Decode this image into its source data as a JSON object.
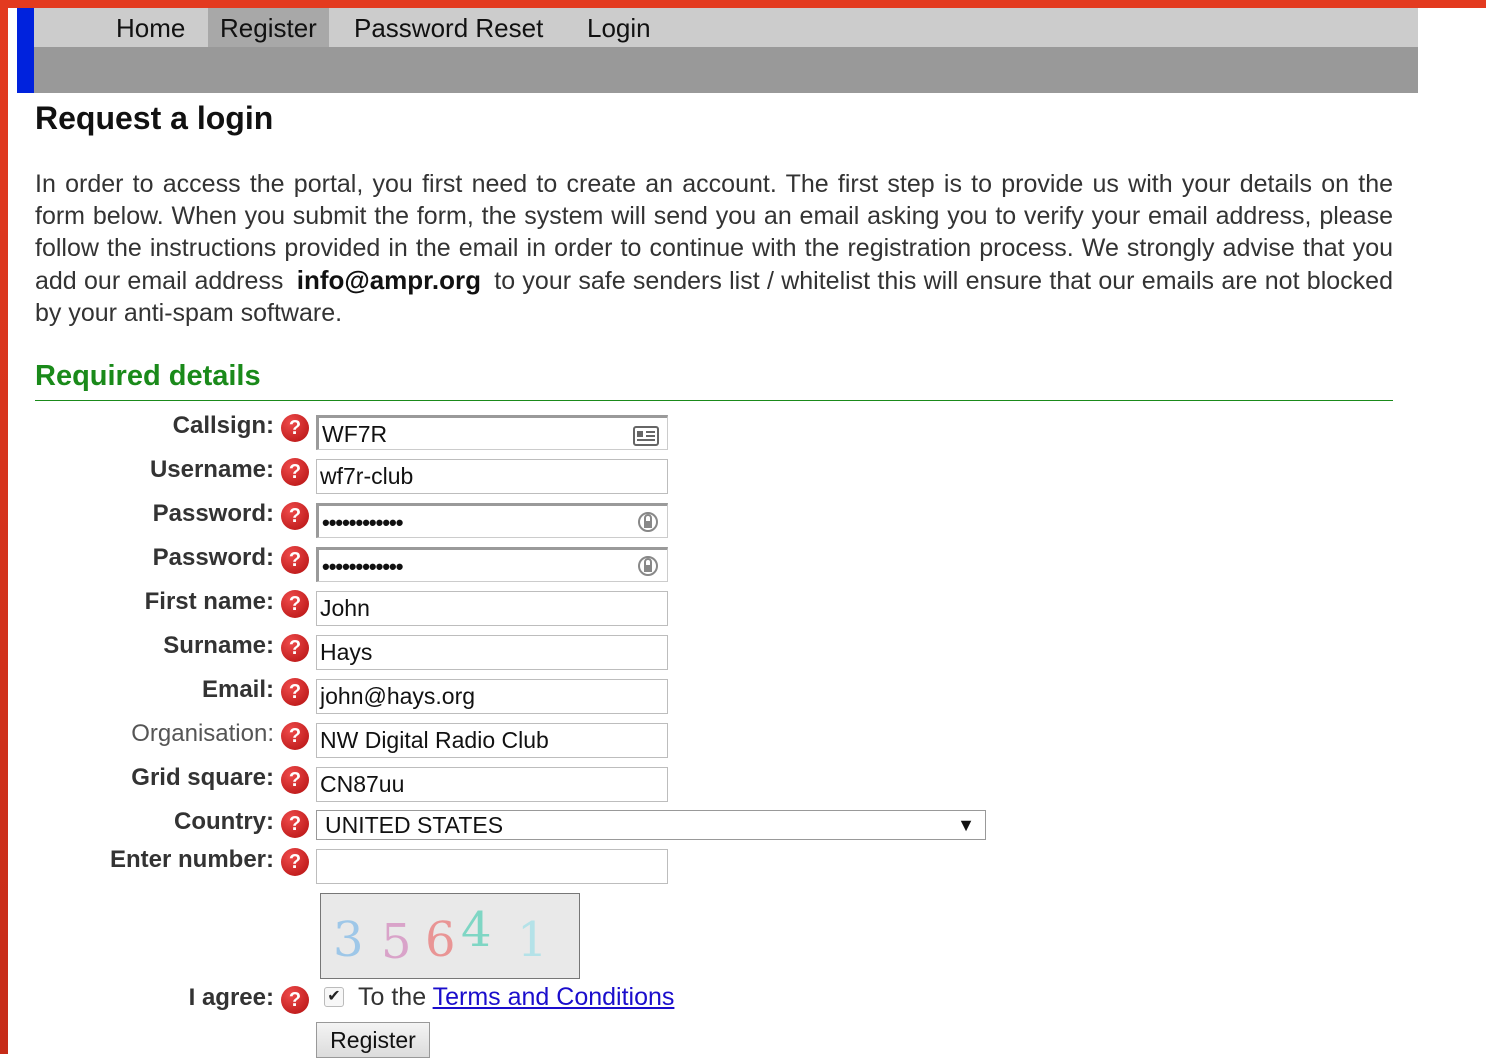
{
  "nav": {
    "items": [
      {
        "label": "Home"
      },
      {
        "label": "Register"
      },
      {
        "label": "Password Reset"
      },
      {
        "label": "Login"
      }
    ],
    "active": "Register"
  },
  "page_title": "Request a login",
  "intro": {
    "text_1": "In order to access the portal, you first need to create an account. The first step is to provide us with your details on the form below. When you submit the form, the system will send you an email asking you to verify your email address, please follow the instructions provided in the email in order to continue with the registration process. We strongly advise that you add our email address",
    "email": "info@ampr.org",
    "text_2": "to your safe senders list / whitelist this will ensure that our emails are not blocked by your anti-spam software."
  },
  "section_title": "Required details",
  "help_glyph": "?",
  "form": {
    "callsign": {
      "label": "Callsign:",
      "value": "WF7R"
    },
    "username": {
      "label": "Username:",
      "value": "wf7r-club"
    },
    "password": {
      "label": "Password:",
      "value": "••••••••••••"
    },
    "password_confirm": {
      "label": "Password:",
      "value": "••••••••••••"
    },
    "first_name": {
      "label": "First name:",
      "value": "John"
    },
    "surname": {
      "label": "Surname:",
      "value": "Hays"
    },
    "email": {
      "label": "Email:",
      "value": "john@hays.org"
    },
    "organisation": {
      "label": "Organisation:",
      "value": "NW Digital Radio Club"
    },
    "grid_square": {
      "label": "Grid square:",
      "value": "CN87uu"
    },
    "country": {
      "label": "Country:",
      "value": "UNITED STATES"
    },
    "enter_number": {
      "label": "Enter number:",
      "value": ""
    },
    "captcha_digits": [
      "3",
      "5",
      "6",
      "4",
      "1"
    ],
    "agree": {
      "label": "I agree:",
      "text": "To the",
      "link": "Terms and Conditions",
      "checked": true
    },
    "register_button": "Register"
  },
  "icons": {
    "contact_card": "contact-card-icon",
    "password_key": "password-manager-icon",
    "help": "help-icon"
  },
  "colors": {
    "frame": "#e33a1f",
    "accent_bar": "#0022dd",
    "section_title": "#1a8a1a",
    "help_icon": "#c41a1a",
    "link": "#1a0dcc"
  }
}
